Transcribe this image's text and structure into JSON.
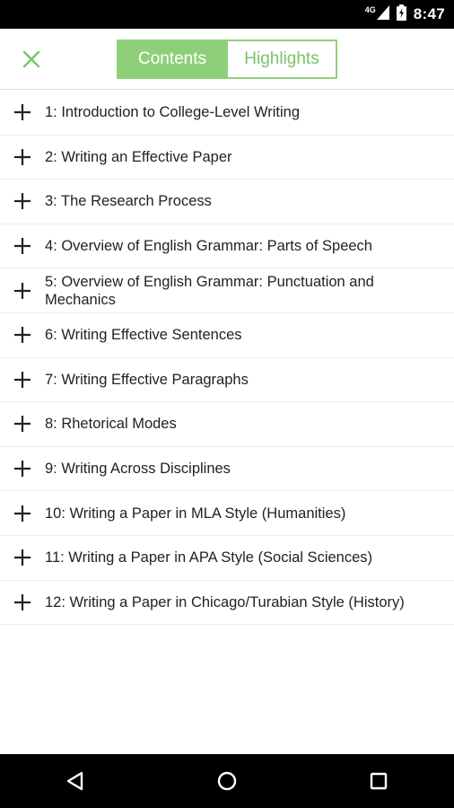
{
  "status_bar": {
    "network": "4G",
    "time": "8:47",
    "icons": [
      "signal-icon",
      "battery-icon"
    ]
  },
  "header": {
    "close_icon": "close-icon",
    "tabs": [
      {
        "label": "Contents",
        "active": true
      },
      {
        "label": "Highlights",
        "active": false
      }
    ],
    "accent_color": "#8ed07a"
  },
  "chapters": [
    {
      "label": "1: Introduction to College-Level Writing"
    },
    {
      "label": "2: Writing an Effective Paper"
    },
    {
      "label": "3: The Research Process"
    },
    {
      "label": "4: Overview of English Grammar: Parts of Speech"
    },
    {
      "label": "5: Overview of English Grammar: Punctuation and Mechanics"
    },
    {
      "label": "6: Writing Effective Sentences"
    },
    {
      "label": "7: Writing Effective Paragraphs"
    },
    {
      "label": "8: Rhetorical Modes"
    },
    {
      "label": "9: Writing Across Disciplines"
    },
    {
      "label": "10: Writing a Paper in MLA Style (Humanities)"
    },
    {
      "label": "11: Writing a Paper in APA Style (Social Sciences)"
    },
    {
      "label": "12: Writing a Paper in Chicago/Turabian Style (History)"
    }
  ],
  "nav_bar": {
    "icons": [
      "back-icon",
      "home-icon",
      "recents-icon"
    ]
  }
}
